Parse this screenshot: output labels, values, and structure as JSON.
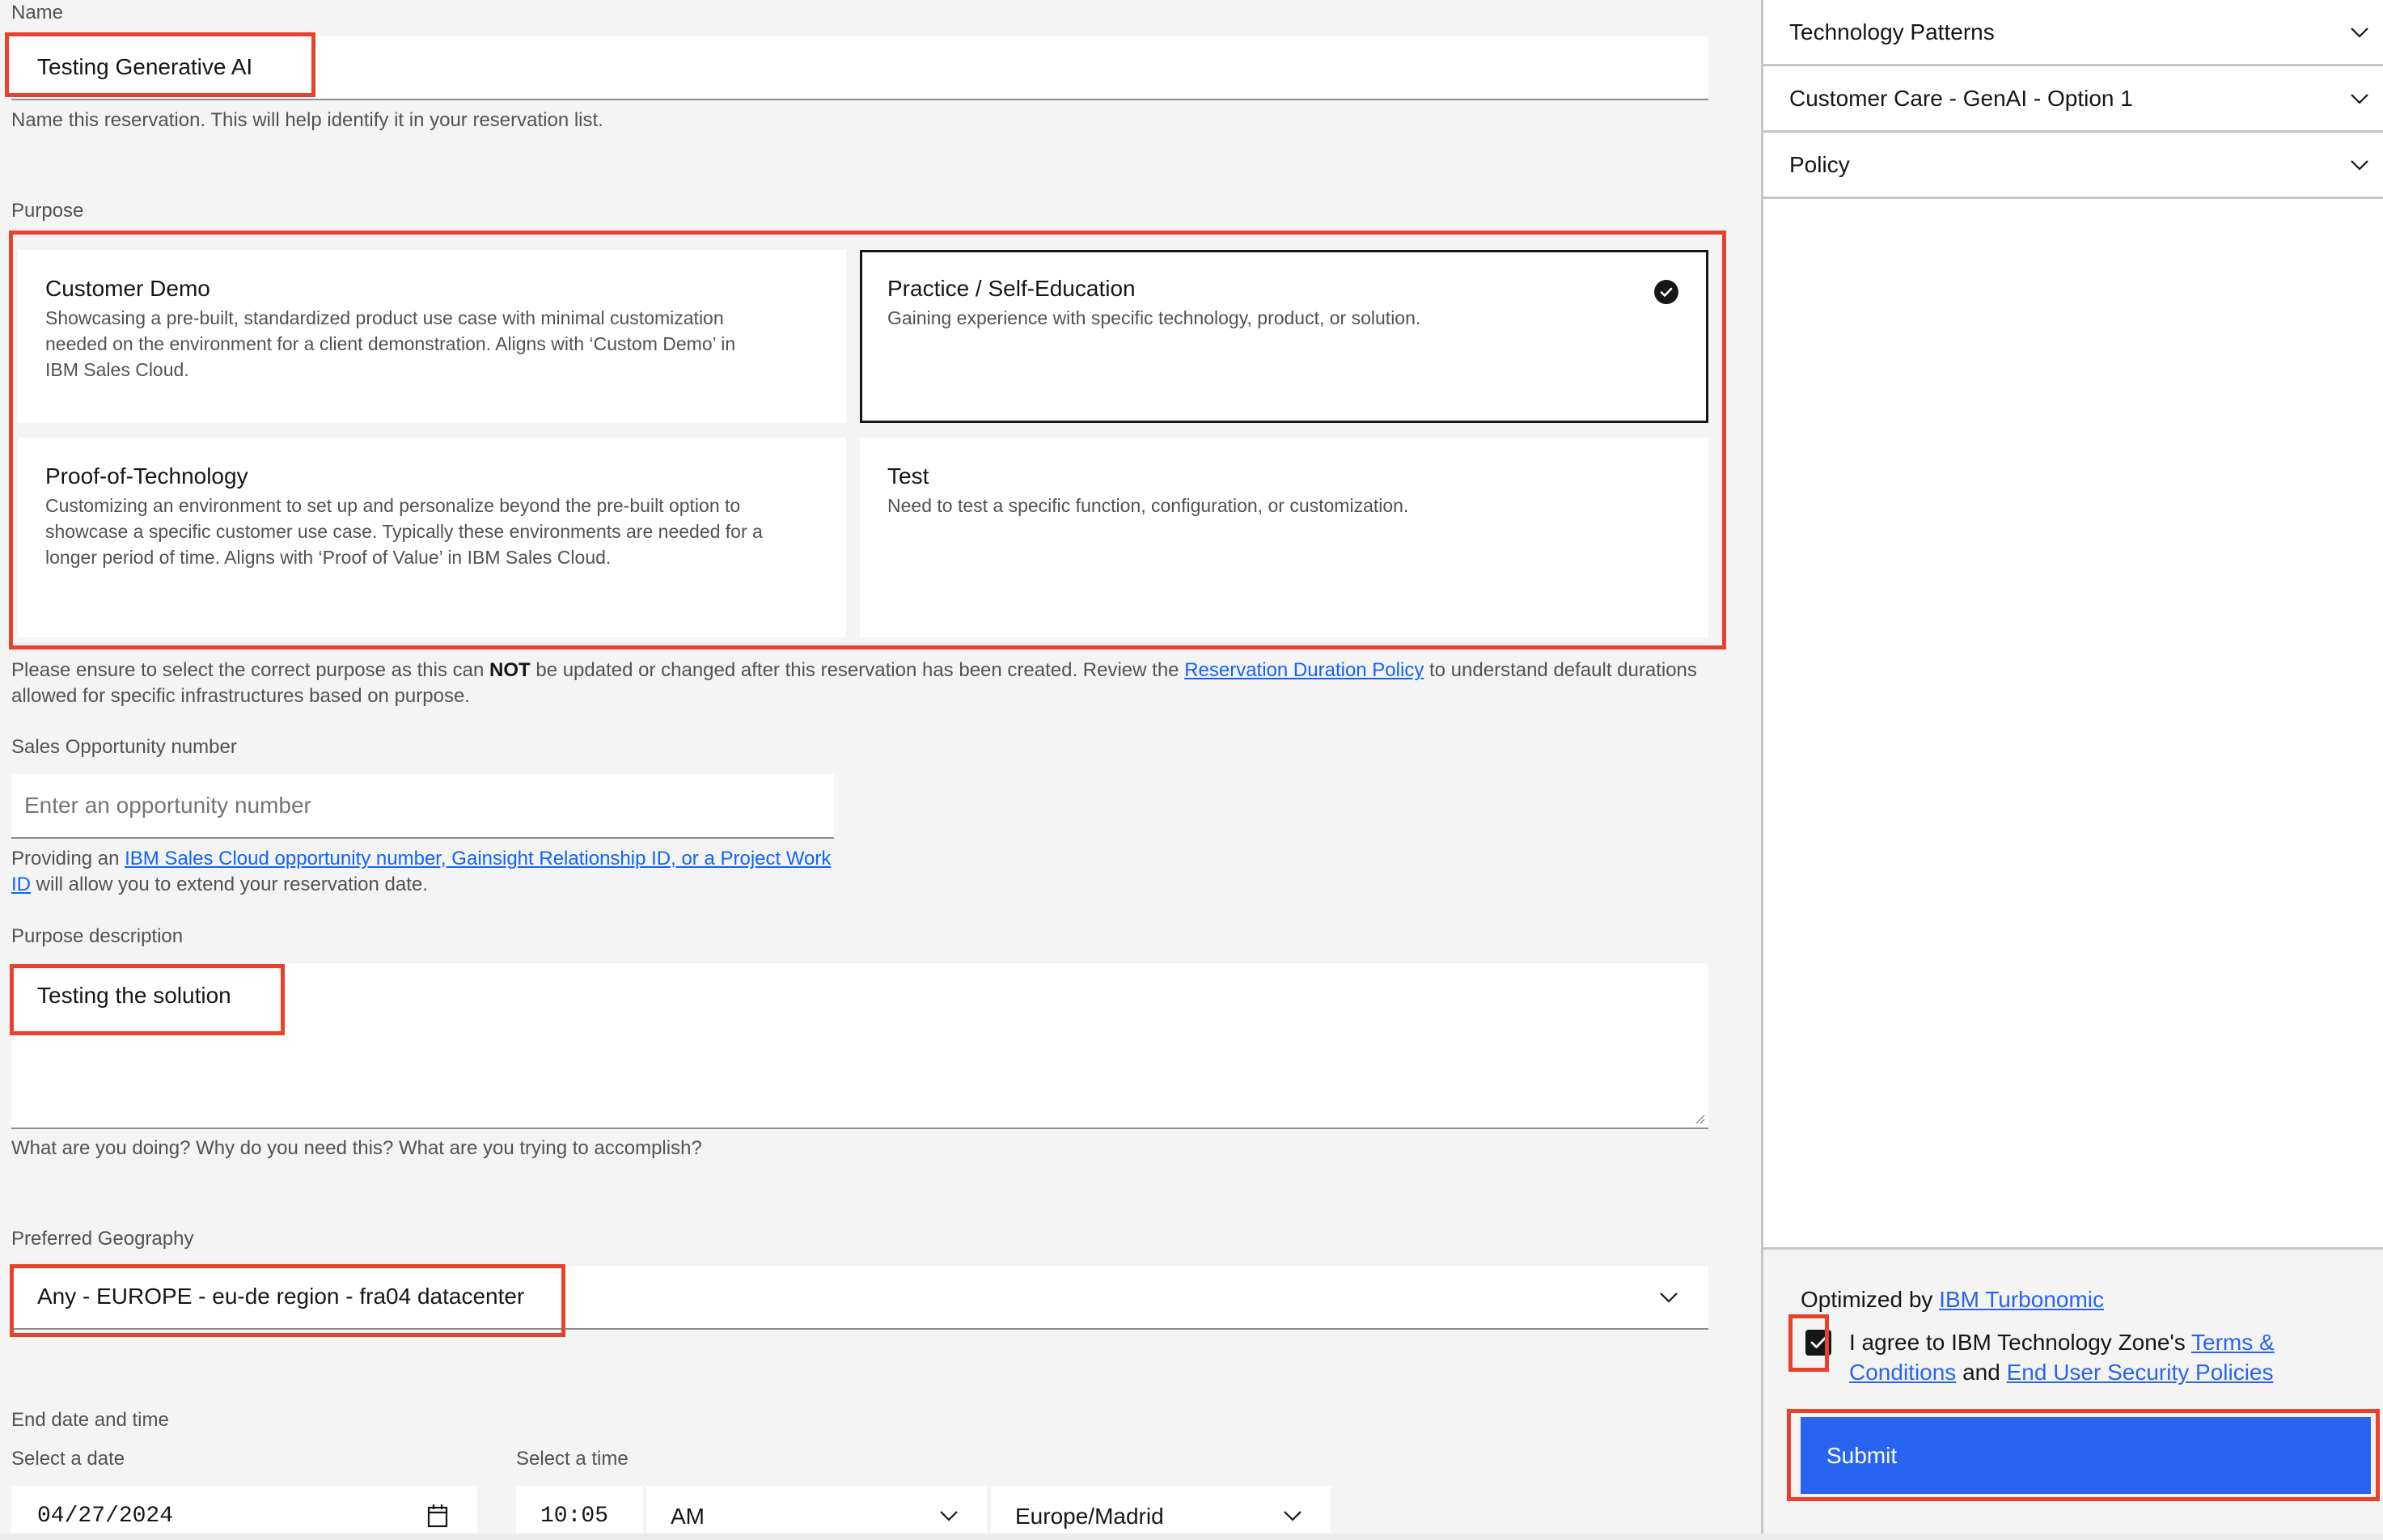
{
  "name_field": {
    "label": "Name",
    "value": "Testing Generative AI",
    "helper": "Name this reservation. This will help identify it in your reservation list."
  },
  "purpose": {
    "label": "Purpose",
    "selected": "Practice / Self-Education",
    "options": [
      {
        "title": "Customer Demo",
        "description": "Showcasing a pre-built, standardized product use case with minimal customization needed on the environment for a client demonstration. Aligns with ‘Custom Demo’ in IBM Sales Cloud.",
        "selected": false
      },
      {
        "title": "Practice / Self-Education",
        "description": "Gaining experience with specific technology, product, or solution.",
        "selected": true
      },
      {
        "title": "Proof-of-Technology",
        "description": "Customizing an environment to set up and personalize beyond the pre-built option to showcase a specific customer use case. Typically these environments are needed for a longer period of time. Aligns with ‘Proof of Value’ in IBM Sales Cloud.",
        "selected": false
      },
      {
        "title": "Test",
        "description": "Need to test a specific function, configuration, or customization.",
        "selected": false
      }
    ],
    "note_before_bold": "Please ensure to select the correct purpose as this can ",
    "note_bold": "NOT",
    "note_after_bold": " be updated or changed after this reservation has been created. Review the ",
    "note_link": "Reservation Duration Policy",
    "note_end": " to understand default durations allowed for specific infrastructures based on purpose."
  },
  "opportunity": {
    "label": "Sales Opportunity number",
    "value": "",
    "placeholder": "Enter an opportunity number",
    "helper_start": "Providing an ",
    "helper_link": "IBM Sales Cloud opportunity number, Gainsight Relationship ID, or a Project Work ID",
    "helper_end": " will allow you to extend your reservation date."
  },
  "purpose_description": {
    "label": "Purpose description",
    "value": "Testing the solution",
    "helper": "What are you doing? Why do you need this? What are you trying to accomplish?"
  },
  "geography": {
    "label": "Preferred Geography",
    "value": "Any - EUROPE - eu-de region - fra04 datacenter"
  },
  "end_datetime": {
    "label": "End date and time",
    "date_label": "Select a date",
    "date_value": "04/27/2024",
    "time_label": "Select a time",
    "time_value": "10:05",
    "ampm_value": "AM",
    "timezone_value": "Europe/Madrid"
  },
  "side_panel": {
    "accordion": [
      {
        "title": "Technology Patterns"
      },
      {
        "title": "Customer Care - GenAI - Option 1"
      },
      {
        "title": "Policy"
      }
    ],
    "optimized_by_text": "Optimized by ",
    "optimized_by_link": "IBM Turbonomic",
    "agree_checked": true,
    "agree_text": "I agree to IBM Technology Zone's ",
    "terms_link": "Terms & Conditions",
    "and_text": " and ",
    "policies_link": "End User Security Policies",
    "submit_label": "Submit"
  },
  "colors": {
    "annotation": "#e8412c",
    "primary_button": "#2864f0",
    "link": "#0f62fe"
  }
}
